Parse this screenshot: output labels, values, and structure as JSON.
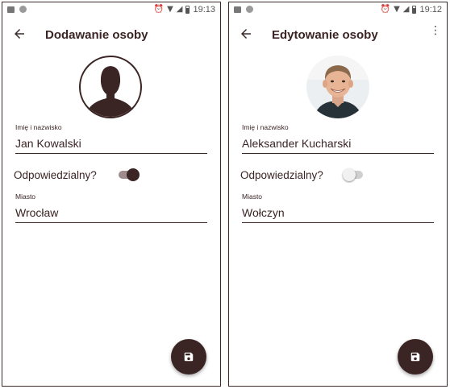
{
  "screens": [
    {
      "status_time": "19:13",
      "title": "Dodawanie osoby",
      "avatar": "default-person-silhouette",
      "name_label": "Imię i nazwisko",
      "name_value": "Jan Kowalski",
      "responsible_label": "Odpowiedzialny?",
      "responsible_on": true,
      "city_label": "Miasto",
      "city_value": "Wrocław",
      "fab_icon": "save-icon"
    },
    {
      "status_time": "19:12",
      "title": "Edytowanie osoby",
      "avatar": "person-photo",
      "name_label": "Imię i nazwisko",
      "name_value": "Aleksander Kucharski",
      "responsible_label": "Odpowiedzialny?",
      "responsible_on": false,
      "city_label": "Miasto",
      "city_value": "Wołczyn",
      "fab_icon": "save-icon",
      "overflow_menu_icon": "more-vert-icon"
    }
  ],
  "colors": {
    "accent": "#3b2424",
    "switch_off_track": "#cfcfcf",
    "switch_on_track": "#9e8b8b"
  }
}
